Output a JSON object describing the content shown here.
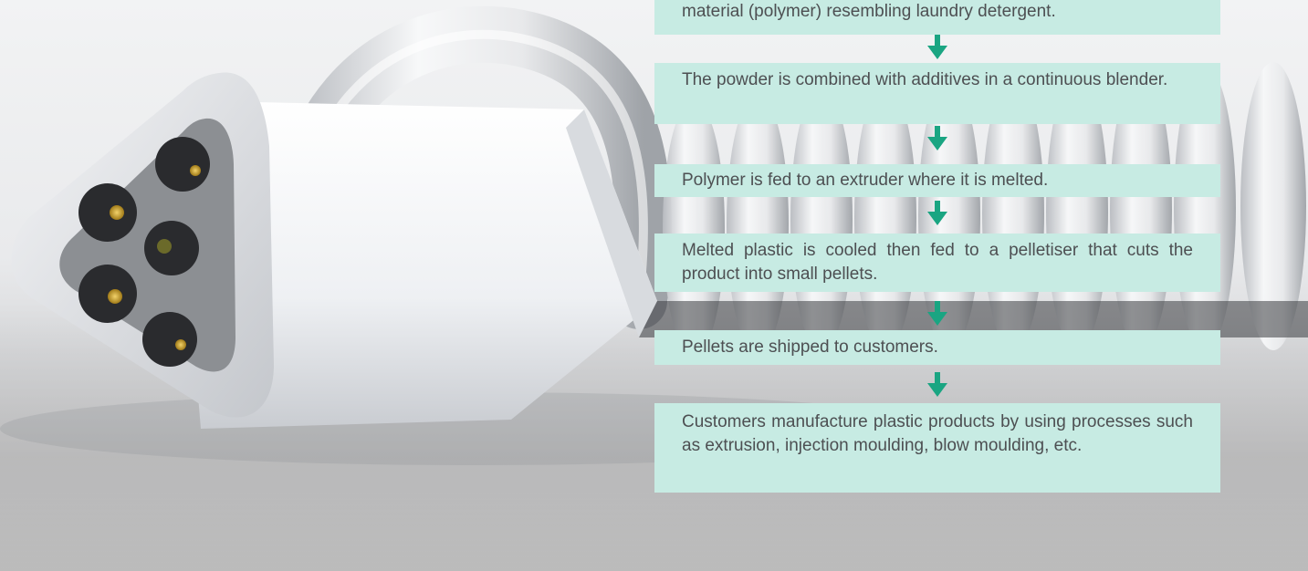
{
  "flowchart": {
    "steps": [
      {
        "text": "material (polymer) resembling laundry detergent."
      },
      {
        "text": "The powder is combined with additives in a continuous blender."
      },
      {
        "text": "Polymer is fed to an extruder where it is melted."
      },
      {
        "text": "Melted plastic is cooled then fed to a pelletiser that cuts the product into small pellets."
      },
      {
        "text": "Pellets are shipped to customers."
      },
      {
        "text": "Customers manufacture plastic products by using processes such as extrusion, injection moulding, blow moulding, etc."
      }
    ],
    "box_color": "#c7ebe3",
    "arrow_color": "#1aa582",
    "text_color": "#4d4f52"
  },
  "background_photo": {
    "icon": "white-coiled-cable-connector-photo"
  }
}
